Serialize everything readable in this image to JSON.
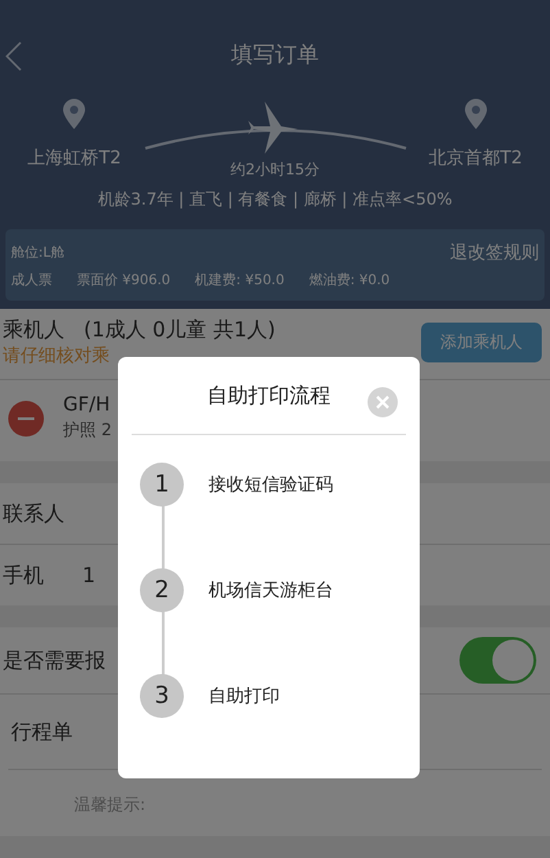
{
  "header": {
    "title": "填写订单",
    "origin": "上海虹桥T2",
    "duration": "约2小时15分",
    "destination": "北京首都T2",
    "info": "机龄3.7年 | 直飞 | 有餐食 | 廊桥 | 准点率<50%"
  },
  "fare": {
    "cabin": "舱位:L舱",
    "rules_link": "退改签规则",
    "items": [
      "成人票",
      "票面价 ¥906.0",
      "机建费: ¥50.0",
      "燃油费: ¥0.0"
    ]
  },
  "passengers": {
    "label": "乘机人",
    "count": "(1成人 0儿童 共1人)",
    "warning": "请仔细核对乘",
    "add_button": "添加乘机人",
    "list": [
      {
        "name": "GF/H",
        "document": "护照 2"
      }
    ]
  },
  "contact": [
    {
      "label": "联系人"
    },
    {
      "label": "手机",
      "value": "1"
    }
  ],
  "reimbursement": {
    "label": "是否需要报",
    "on": true
  },
  "itinerary": {
    "label": "行程单",
    "tip": "温馨提示:"
  },
  "modal": {
    "title": "自助打印流程",
    "steps": [
      {
        "number": "1",
        "text": "接收短信验证码"
      },
      {
        "number": "2",
        "text": "机场信天游柜台"
      },
      {
        "number": "3",
        "text": "自助打印"
      }
    ]
  }
}
